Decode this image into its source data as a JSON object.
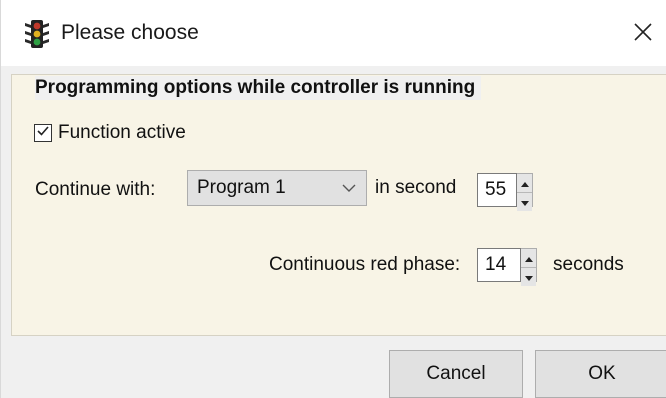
{
  "window": {
    "title": "Please choose",
    "icon": "traffic-light-icon",
    "close_icon": "close-icon"
  },
  "group": {
    "title": "Programming options while controller is running"
  },
  "function_active": {
    "label": "Function active",
    "checked": true
  },
  "continue_with": {
    "label": "Continue with:",
    "selected": "Program 1",
    "in_second_label": "in second",
    "second_value": "55"
  },
  "red_phase": {
    "label": "Continuous red phase:",
    "value": "14",
    "unit_label": "seconds"
  },
  "buttons": {
    "cancel": "Cancel",
    "ok": "OK"
  },
  "colors": {
    "panel_background": "#f8f4e6",
    "button_face": "#e1e1e1",
    "traffic_light_red": "#c0392b",
    "traffic_light_yellow": "#e0b020",
    "traffic_light_green": "#2ea043"
  }
}
